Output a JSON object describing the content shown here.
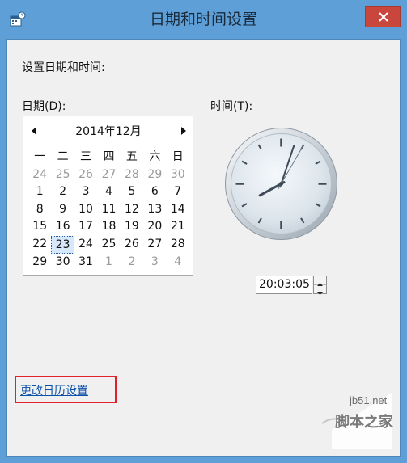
{
  "window": {
    "title": "日期和时间设置"
  },
  "main": {
    "heading": "设置日期和时间:",
    "date_label": "日期(D):",
    "time_label": "时间(T):",
    "link_label": "更改日历设置"
  },
  "calendar": {
    "month_label": "2014年12月",
    "weekdays": [
      "一",
      "二",
      "三",
      "四",
      "五",
      "六",
      "日"
    ],
    "weeks": [
      [
        {
          "d": "24",
          "dim": true
        },
        {
          "d": "25",
          "dim": true
        },
        {
          "d": "26",
          "dim": true
        },
        {
          "d": "27",
          "dim": true
        },
        {
          "d": "28",
          "dim": true
        },
        {
          "d": "29",
          "dim": true
        },
        {
          "d": "30",
          "dim": true
        }
      ],
      [
        {
          "d": "1"
        },
        {
          "d": "2"
        },
        {
          "d": "3"
        },
        {
          "d": "4"
        },
        {
          "d": "5"
        },
        {
          "d": "6"
        },
        {
          "d": "7"
        }
      ],
      [
        {
          "d": "8"
        },
        {
          "d": "9"
        },
        {
          "d": "10"
        },
        {
          "d": "11"
        },
        {
          "d": "12"
        },
        {
          "d": "13"
        },
        {
          "d": "14"
        }
      ],
      [
        {
          "d": "15"
        },
        {
          "d": "16"
        },
        {
          "d": "17"
        },
        {
          "d": "18"
        },
        {
          "d": "19"
        },
        {
          "d": "20"
        },
        {
          "d": "21"
        }
      ],
      [
        {
          "d": "22"
        },
        {
          "d": "23",
          "selected": true
        },
        {
          "d": "24"
        },
        {
          "d": "25"
        },
        {
          "d": "26"
        },
        {
          "d": "27"
        },
        {
          "d": "28"
        }
      ],
      [
        {
          "d": "29"
        },
        {
          "d": "30"
        },
        {
          "d": "31"
        },
        {
          "d": "1",
          "dim": true
        },
        {
          "d": "2",
          "dim": true
        },
        {
          "d": "3",
          "dim": true
        },
        {
          "d": "4",
          "dim": true
        }
      ]
    ]
  },
  "time": {
    "value": "20:03:05",
    "hours": 20,
    "minutes": 3,
    "seconds": 5
  },
  "watermark": {
    "url": "jb51.net",
    "name": "脚本之家"
  },
  "icons": {
    "app": "date-time-settings-icon",
    "close": "close-icon",
    "prev": "triangle-left-icon",
    "next": "triangle-right-icon",
    "up": "spin-up-icon",
    "down": "spin-down-icon"
  },
  "colors": {
    "titlebar": "#5d9fd6",
    "close_button": "#c9463d",
    "link": "#0a4fa8",
    "highlight": "#e0202a"
  }
}
